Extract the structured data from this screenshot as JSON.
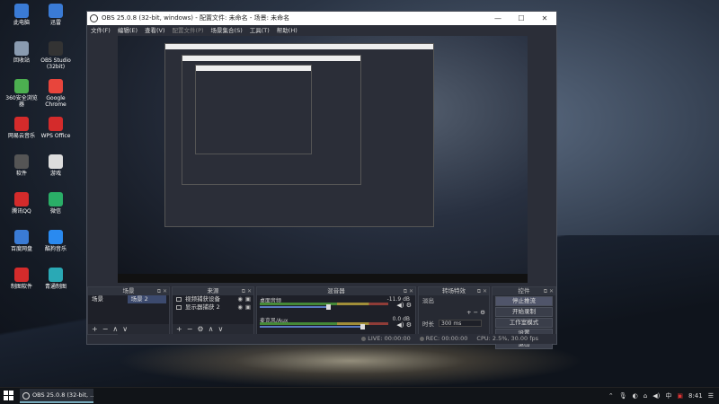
{
  "desktop": {
    "icons": [
      {
        "label": "此电脑",
        "icon": "computer-icon",
        "color": "#3a7bd5"
      },
      {
        "label": "迅雷",
        "icon": "thunder-icon",
        "color": "#3a7bd5"
      },
      {
        "label": "回收站",
        "icon": "recycle-bin-icon",
        "color": "#8a9bb0"
      },
      {
        "label": "OBS Studio (32bit)",
        "icon": "obs-icon",
        "color": "#333333"
      },
      {
        "label": "360安全浏览器",
        "icon": "browser-360-icon",
        "color": "#4caf50"
      },
      {
        "label": "Google Chrome",
        "icon": "chrome-icon",
        "color": "#e8453c"
      },
      {
        "label": "网易云音乐",
        "icon": "netease-music-icon",
        "color": "#d42b2b"
      },
      {
        "label": "WPS Office",
        "icon": "wps-icon",
        "color": "#d42b2b"
      },
      {
        "label": "软件",
        "icon": "software-icon",
        "color": "#555555"
      },
      {
        "label": "游戏",
        "icon": "gamepad-icon",
        "color": "#dddddd"
      },
      {
        "label": "腾讯QQ",
        "icon": "qq-icon",
        "color": "#d42b2b"
      },
      {
        "label": "微信",
        "icon": "wechat-icon",
        "color": "#2aae67"
      },
      {
        "label": "百度网盘",
        "icon": "baidu-netdisk-icon",
        "color": "#3a7bd5"
      },
      {
        "label": "酷狗音乐",
        "icon": "kugou-icon",
        "color": "#2a8af0"
      },
      {
        "label": "制图软件",
        "icon": "design-software-icon",
        "color": "#d42b2b"
      },
      {
        "label": "青通制图",
        "icon": "qingtong-icon",
        "color": "#2aa9b5"
      }
    ]
  },
  "obs": {
    "title": "OBS 25.0.8 (32-bit, windows) - 配置文件: 未命名 - 场景: 未命名",
    "window_controls": [
      "—",
      "☐",
      "✕"
    ],
    "menu": [
      {
        "label": "文件(F)",
        "enabled": true
      },
      {
        "label": "编辑(E)",
        "enabled": true
      },
      {
        "label": "查看(V)",
        "enabled": true
      },
      {
        "label": "配置文件(P)",
        "enabled": false
      },
      {
        "label": "场景集合(S)",
        "enabled": true
      },
      {
        "label": "工具(T)",
        "enabled": true
      },
      {
        "label": "帮助(H)",
        "enabled": true
      }
    ],
    "scenes": {
      "title": "场景",
      "items": [
        "场景",
        "场景 2"
      ],
      "selected_index": 1,
      "footer": [
        "+",
        "−",
        "∧",
        "∨"
      ]
    },
    "sources": {
      "title": "来源",
      "items": [
        "视频捕获设备",
        "显示器捕获 2"
      ],
      "footer": [
        "+",
        "−",
        "⚙",
        "∧",
        "∨"
      ]
    },
    "mixer": {
      "title": "混音器",
      "channels": [
        {
          "name": "桌面音频",
          "db": "-11.9 dB",
          "level": 0.55
        },
        {
          "name": "麦克风/Aux",
          "db": "0.0 dB",
          "level": 0.82
        }
      ]
    },
    "transitions": {
      "title": "转场特效",
      "type": "淡出",
      "duration_label": "时长",
      "duration_value": "300 ms"
    },
    "controls": {
      "title": "控件",
      "buttons": [
        "停止推流",
        "开始录制",
        "工作室模式",
        "设置",
        "退出"
      ],
      "active_index": 0
    },
    "status": {
      "live": "LIVE: 00:00:00",
      "rec": "REC: 00:00:00",
      "cpu": "CPU: 2.5%, 30.00 fps"
    }
  },
  "taskbar": {
    "app_label": "OBS 25.0.8 (32-bit, ...",
    "ime": "中",
    "time": "8:41",
    "tray_icons": [
      "chevron-up-icon",
      "microphone-icon",
      "volume-icon",
      "network-icon",
      "speaker-icon"
    ]
  }
}
